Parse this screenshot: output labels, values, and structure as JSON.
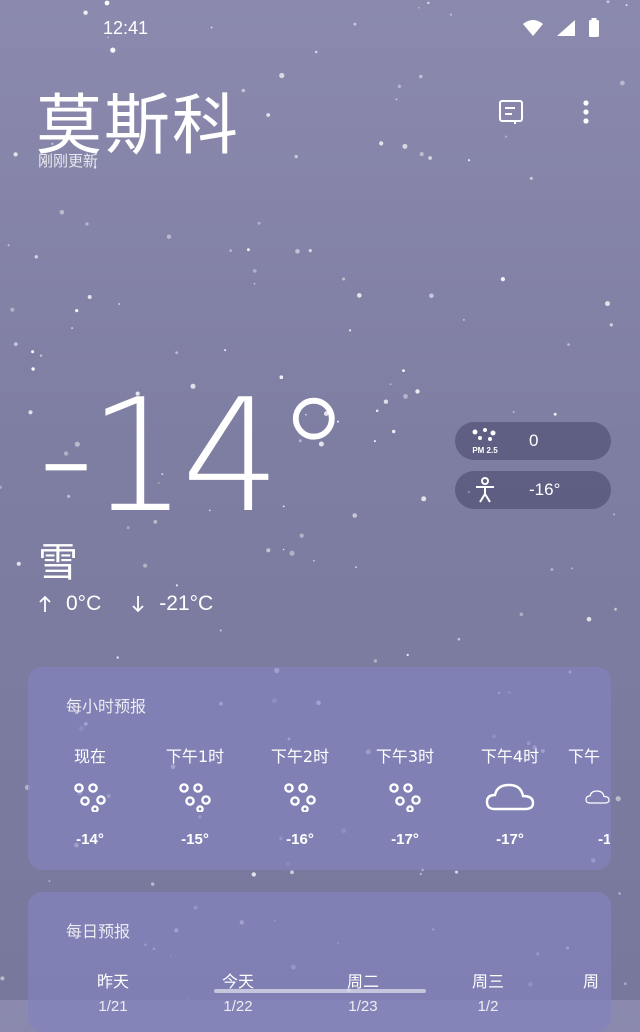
{
  "status": {
    "time": "12:41"
  },
  "header": {
    "city": "莫斯科",
    "updated": "刚刚更新"
  },
  "current": {
    "temp": "-14°",
    "condition": "雪",
    "high": "0°C",
    "low": "-21°C",
    "aqi_label": "PM 2.5",
    "aqi_value": "0",
    "feels_like": "-16°"
  },
  "hourly": {
    "title": "每小时预报",
    "items": [
      {
        "label": "现在",
        "icon": "snow-icon",
        "temp": "-14°"
      },
      {
        "label": "下午1时",
        "icon": "snow-icon",
        "temp": "-15°"
      },
      {
        "label": "下午2时",
        "icon": "snow-icon",
        "temp": "-16°"
      },
      {
        "label": "下午3时",
        "icon": "snow-icon",
        "temp": "-17°"
      },
      {
        "label": "下午4时",
        "icon": "cloud-icon",
        "temp": "-17°"
      },
      {
        "label": "下午",
        "icon": "cloud-icon",
        "temp": "-1"
      }
    ]
  },
  "daily": {
    "title": "每日预报",
    "items": [
      {
        "label": "昨天",
        "date": "1/21"
      },
      {
        "label": "今天",
        "date": "1/22"
      },
      {
        "label": "周二",
        "date": "1/23"
      },
      {
        "label": "周三",
        "date": "1/2"
      },
      {
        "label": "周"
      }
    ]
  },
  "colors": {
    "background": "#8b8aae",
    "card": "#8282bc",
    "pill": "#46466a",
    "text": "#ffffff"
  }
}
